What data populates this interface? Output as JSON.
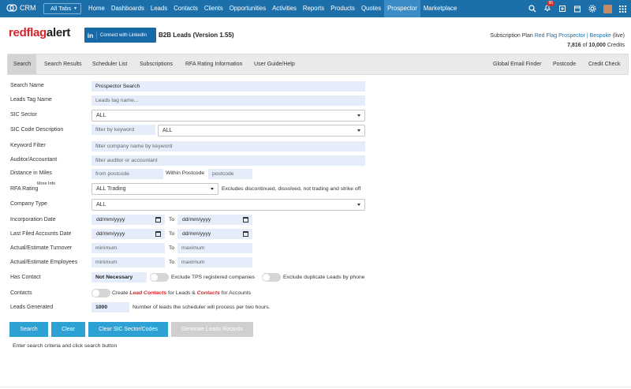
{
  "topnav": {
    "brand": "CRM",
    "all_tabs": "All Tabs",
    "items": [
      "Home",
      "Dashboards",
      "Leads",
      "Contacts",
      "Clients",
      "Opportunities",
      "Activities",
      "Reports",
      "Products",
      "Quotes",
      "Prospector",
      "Marketplace"
    ],
    "active": "Prospector",
    "notification_count": "95"
  },
  "header": {
    "logo_red": "redflag",
    "logo_dark": "alert",
    "linkedin_label": "Connect with LinkedIn",
    "linkedin_icon": "in",
    "title": "B2B Leads (Version 1.55)",
    "subscription_prefix": "Subscription Plan",
    "subscription_link": "Red Flag Prospector | Bespoke",
    "subscription_suffix": "(live)",
    "credits_used": "7,816",
    "credits_of": "of",
    "credits_total": "10,000",
    "credits_label": "Credits"
  },
  "tabs": {
    "left": [
      "Search",
      "Search Results",
      "Scheduler List",
      "Subscriptions",
      "RFA Rating Information",
      "User Guide/Help"
    ],
    "right": [
      "Global Email Finder",
      "Postcode",
      "Credit Check"
    ],
    "active": "Search"
  },
  "form": {
    "search_name_label": "Search Name",
    "search_name_value": "Prospector Search",
    "leads_tag_label": "Leads Tag Name",
    "leads_tag_placeholder": "Leads tag name...",
    "sic_sector_label": "SIC Sector",
    "sic_sector_value": "ALL",
    "sic_code_label": "SIC Code Description",
    "sic_keyword_placeholder": "filter by keyword",
    "sic_code_value": "ALL",
    "keyword_label": "Keyword Filter",
    "keyword_placeholder": "filter company name by keyword",
    "auditor_label": "Auditor/Accountant",
    "auditor_placeholder": "filter auditor or accountant",
    "distance_label": "Distance in Miles",
    "distance_placeholder": "from postcode",
    "within_postcode": "Within Postcode",
    "postcode_placeholder": "postcode",
    "rfa_label": "RFA Rating",
    "more_info": "More Info",
    "rfa_value": "ALL Trading",
    "rfa_note": "Excludes discontinued, dissolved, not trading and strike off",
    "company_type_label": "Company Type",
    "company_type_value": "ALL",
    "incorporation_label": "Incorporation Date",
    "last_filed_label": "Last Filed Accounts Date",
    "date_placeholder": "dd/mm/yyyy",
    "to": "To",
    "turnover_label": "Actual/Estimate Turnover",
    "employees_label": "Actual/Estimate Employees",
    "minimum": "minimum",
    "maximum": "maximum",
    "has_contact_label": "Has Contact",
    "has_contact_value": "Not Necessary",
    "exclude_tps": "Exclude TPS registered companies",
    "exclude_dup": "Exclude duplicate Leads by phone",
    "contacts_label": "Contacts",
    "create": "Create",
    "lead_contacts": "Lead Contacts",
    "for_leads": "for Leads &",
    "contacts_link": "Contacts",
    "for_accounts": "for Accounts",
    "leads_generated_label": "Leads Generated",
    "leads_generated_value": "1000",
    "leads_generated_note": "Number of leads the scheduler will process per two hours."
  },
  "buttons": {
    "search": "Search",
    "clear": "Clear",
    "clear_sic": "Clear SIC Sector/Codes",
    "generate": "Generate Leads Records"
  },
  "footer_note": "Enter search criteria and click search button"
}
